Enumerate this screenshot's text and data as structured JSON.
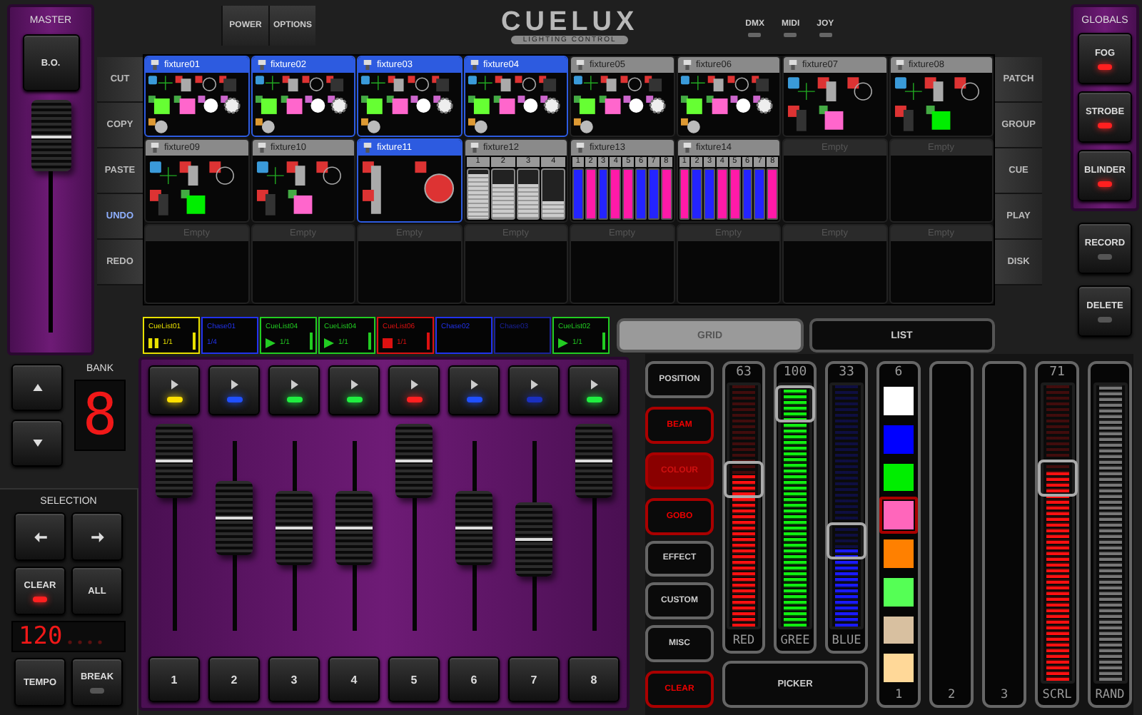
{
  "master": {
    "title": "MASTER",
    "button": "B.O.",
    "level": 1
  },
  "tools_left": [
    {
      "label": "CUT",
      "selected": false
    },
    {
      "label": "COPY",
      "selected": false
    },
    {
      "label": "PASTE",
      "selected": false
    },
    {
      "label": "UNDO",
      "selected": true
    },
    {
      "label": "REDO",
      "selected": false
    }
  ],
  "top_buttons": [
    "POWER",
    "OPTIONS"
  ],
  "logo": {
    "name": "CUELUX",
    "tagline": "LIGHTING CONTROL"
  },
  "indicators": [
    {
      "label": "DMX",
      "on": false
    },
    {
      "label": "MIDI",
      "on": false
    },
    {
      "label": "JOY",
      "on": false
    }
  ],
  "fixture_rows": [
    [
      {
        "kind": "moving_head",
        "name": "fixture01",
        "selected": true
      },
      {
        "kind": "moving_head",
        "name": "fixture02",
        "selected": true
      },
      {
        "kind": "moving_head",
        "name": "fixture03",
        "selected": true
      },
      {
        "kind": "moving_head",
        "name": "fixture04",
        "selected": true
      },
      {
        "kind": "moving_head",
        "name": "fixture05",
        "selected": false
      },
      {
        "kind": "moving_head",
        "name": "fixture06",
        "selected": false
      },
      {
        "kind": "scanner",
        "name": "fixture07",
        "selected": false,
        "color": "#ff66cc"
      },
      {
        "kind": "scanner",
        "name": "fixture08",
        "selected": false,
        "color": "#00ee00"
      }
    ],
    [
      {
        "kind": "scanner",
        "name": "fixture09",
        "selected": false,
        "color": "#00ee00"
      },
      {
        "kind": "scanner",
        "name": "fixture10",
        "selected": false,
        "color": "#ff66cc"
      },
      {
        "kind": "par",
        "name": "fixture11",
        "selected": true
      },
      {
        "kind": "dimmer",
        "name": "fixture12",
        "selected": false,
        "channels": [
          {
            "label": "1",
            "level": 0.9
          },
          {
            "label": "2",
            "level": 0.7
          },
          {
            "label": "3",
            "level": 0.7
          },
          {
            "label": "4",
            "level": 0.35
          }
        ]
      },
      {
        "kind": "led_bar",
        "name": "fixture13",
        "selected": false,
        "channels": [
          {
            "label": "1",
            "color": "#2424ff"
          },
          {
            "label": "2",
            "color": "#ff1aa8"
          },
          {
            "label": "3",
            "color": "#2424ff"
          },
          {
            "label": "4",
            "color": "#ff1aa8"
          },
          {
            "label": "5",
            "color": "#ff1aa8"
          },
          {
            "label": "6",
            "color": "#2424ff"
          },
          {
            "label": "7",
            "color": "#2424ff"
          },
          {
            "label": "8",
            "color": "#ff1aa8"
          }
        ]
      },
      {
        "kind": "led_bar",
        "name": "fixture14",
        "selected": false,
        "channels": [
          {
            "label": "1",
            "color": "#ff1aa8"
          },
          {
            "label": "2",
            "color": "#2424ff"
          },
          {
            "label": "3",
            "color": "#2424ff"
          },
          {
            "label": "4",
            "color": "#ff1aa8"
          },
          {
            "label": "5",
            "color": "#ff1aa8"
          },
          {
            "label": "6",
            "color": "#2424ff"
          },
          {
            "label": "7",
            "color": "#2424ff"
          },
          {
            "label": "8",
            "color": "#ff1aa8"
          }
        ]
      },
      {
        "kind": "empty",
        "label": "Empty"
      },
      {
        "kind": "empty",
        "label": "Empty"
      }
    ],
    [
      {
        "kind": "empty",
        "label": "Empty"
      },
      {
        "kind": "empty",
        "label": "Empty"
      },
      {
        "kind": "empty",
        "label": "Empty"
      },
      {
        "kind": "empty",
        "label": "Empty"
      },
      {
        "kind": "empty",
        "label": "Empty"
      },
      {
        "kind": "empty",
        "label": "Empty"
      },
      {
        "kind": "empty",
        "label": "Empty"
      },
      {
        "kind": "empty",
        "label": "Empty"
      }
    ]
  ],
  "cues": [
    {
      "name": "CueList01",
      "counter": "1/1",
      "color": "#e8e000",
      "kind": "paused"
    },
    {
      "name": "Chase01",
      "counter": "1/4",
      "color": "#2233ee",
      "kind": "idle"
    },
    {
      "name": "CueList04",
      "counter": "1/1",
      "color": "#22cc22",
      "kind": "playing"
    },
    {
      "name": "CueList04",
      "counter": "1/1",
      "color": "#22cc22",
      "kind": "playing"
    },
    {
      "name": "CueList06",
      "counter": "1/1",
      "color": "#dd1111",
      "kind": "stopped"
    },
    {
      "name": "Chase02",
      "color": "#2233ee",
      "kind": "idle"
    },
    {
      "name": "Chase03",
      "color": "#1a2299",
      "kind": "idle"
    },
    {
      "name": "CueList02",
      "counter": "1/1",
      "color": "#22cc22",
      "kind": "playing"
    }
  ],
  "views": [
    {
      "label": "GRID",
      "selected": true
    },
    {
      "label": "LIST",
      "selected": false
    }
  ],
  "tools_right": [
    {
      "label": "PATCH",
      "selected": false
    },
    {
      "label": "GROUP",
      "selected": false
    },
    {
      "label": "CUE",
      "selected": false
    },
    {
      "label": "PLAY",
      "selected": false
    },
    {
      "label": "DISK",
      "selected": false
    }
  ],
  "globals": {
    "title": "GLOBALS",
    "buttons": [
      {
        "label": "FOG",
        "led": true
      },
      {
        "label": "STROBE",
        "led": true
      },
      {
        "label": "BLINDER",
        "led": true
      }
    ]
  },
  "actions": [
    {
      "label": "RECORD",
      "led": false
    },
    {
      "label": "DELETE",
      "led": false
    }
  ],
  "bank": {
    "label": "BANK",
    "value": "8"
  },
  "selection": {
    "title": "SELECTION",
    "buttons": [
      {
        "kind": "prev"
      },
      {
        "kind": "next"
      },
      {
        "kind": "clear",
        "label": "CLEAR",
        "led": true
      },
      {
        "kind": "all",
        "label": "ALL"
      }
    ]
  },
  "tempo": {
    "value": "120"
  },
  "tempo_buttons": [
    {
      "label": "TEMPO"
    },
    {
      "label": "BREAK",
      "led": false
    }
  ],
  "playbacks": [
    {
      "color": "#ffe000",
      "level": 1,
      "number": "1"
    },
    {
      "color": "#2050ff",
      "level": 0.62,
      "number": "2"
    },
    {
      "color": "#20ee40",
      "level": 0.55,
      "number": "3"
    },
    {
      "color": "#20ee40",
      "level": 0.55,
      "number": "4"
    },
    {
      "color": "#ff2020",
      "level": 1,
      "number": "5"
    },
    {
      "color": "#2050ff",
      "level": 0.55,
      "number": "6"
    },
    {
      "color": "#1a30c0",
      "level": 0.48,
      "number": "7"
    },
    {
      "color": "#20ee40",
      "level": 1,
      "number": "8"
    }
  ],
  "categories": [
    {
      "label": "POSITION",
      "active": false,
      "selected": false
    },
    {
      "label": "BEAM",
      "active": true,
      "selected": false
    },
    {
      "label": "COLOUR",
      "active": true,
      "selected": true
    },
    {
      "label": "GOBO",
      "active": true,
      "selected": false
    },
    {
      "label": "EFFECT",
      "active": false,
      "selected": false
    },
    {
      "label": "CUSTOM",
      "active": false,
      "selected": false
    },
    {
      "label": "MISC",
      "active": false,
      "selected": false
    },
    {
      "label": "CLEAR",
      "active": true,
      "selected": false
    }
  ],
  "rgb_strips": [
    {
      "label": "RED",
      "reading": "63",
      "level": 0.63,
      "color": "#ff1111"
    },
    {
      "label": "GREE",
      "reading": "100",
      "level": 1,
      "color": "#11ee11"
    },
    {
      "label": "BLUE",
      "reading": "33",
      "level": 0.33,
      "color": "#1a1aff"
    }
  ],
  "picker": "PICKER",
  "strips": [
    {
      "kind": "palette",
      "reading": "6",
      "label": "1",
      "swatches": [
        {
          "color": "#ffffff",
          "selected": false
        },
        {
          "color": "#0000ff",
          "selected": false
        },
        {
          "color": "#00ee00",
          "selected": false
        },
        {
          "color": "#ff66bb",
          "selected": true
        },
        {
          "color": "#ff8000",
          "selected": false
        },
        {
          "color": "#55ff55",
          "selected": false
        },
        {
          "color": "#d8c0a0",
          "selected": false
        },
        {
          "color": "#ffd898",
          "selected": false
        }
      ]
    },
    {
      "kind": "empty",
      "label": "2"
    },
    {
      "kind": "empty",
      "label": "3"
    },
    {
      "kind": "meter",
      "label": "SCRL",
      "reading": "71",
      "level": 0.71,
      "color": "#ff1111"
    },
    {
      "kind": "meter",
      "label": "RAND",
      "level": 1,
      "color": "#777777"
    }
  ]
}
